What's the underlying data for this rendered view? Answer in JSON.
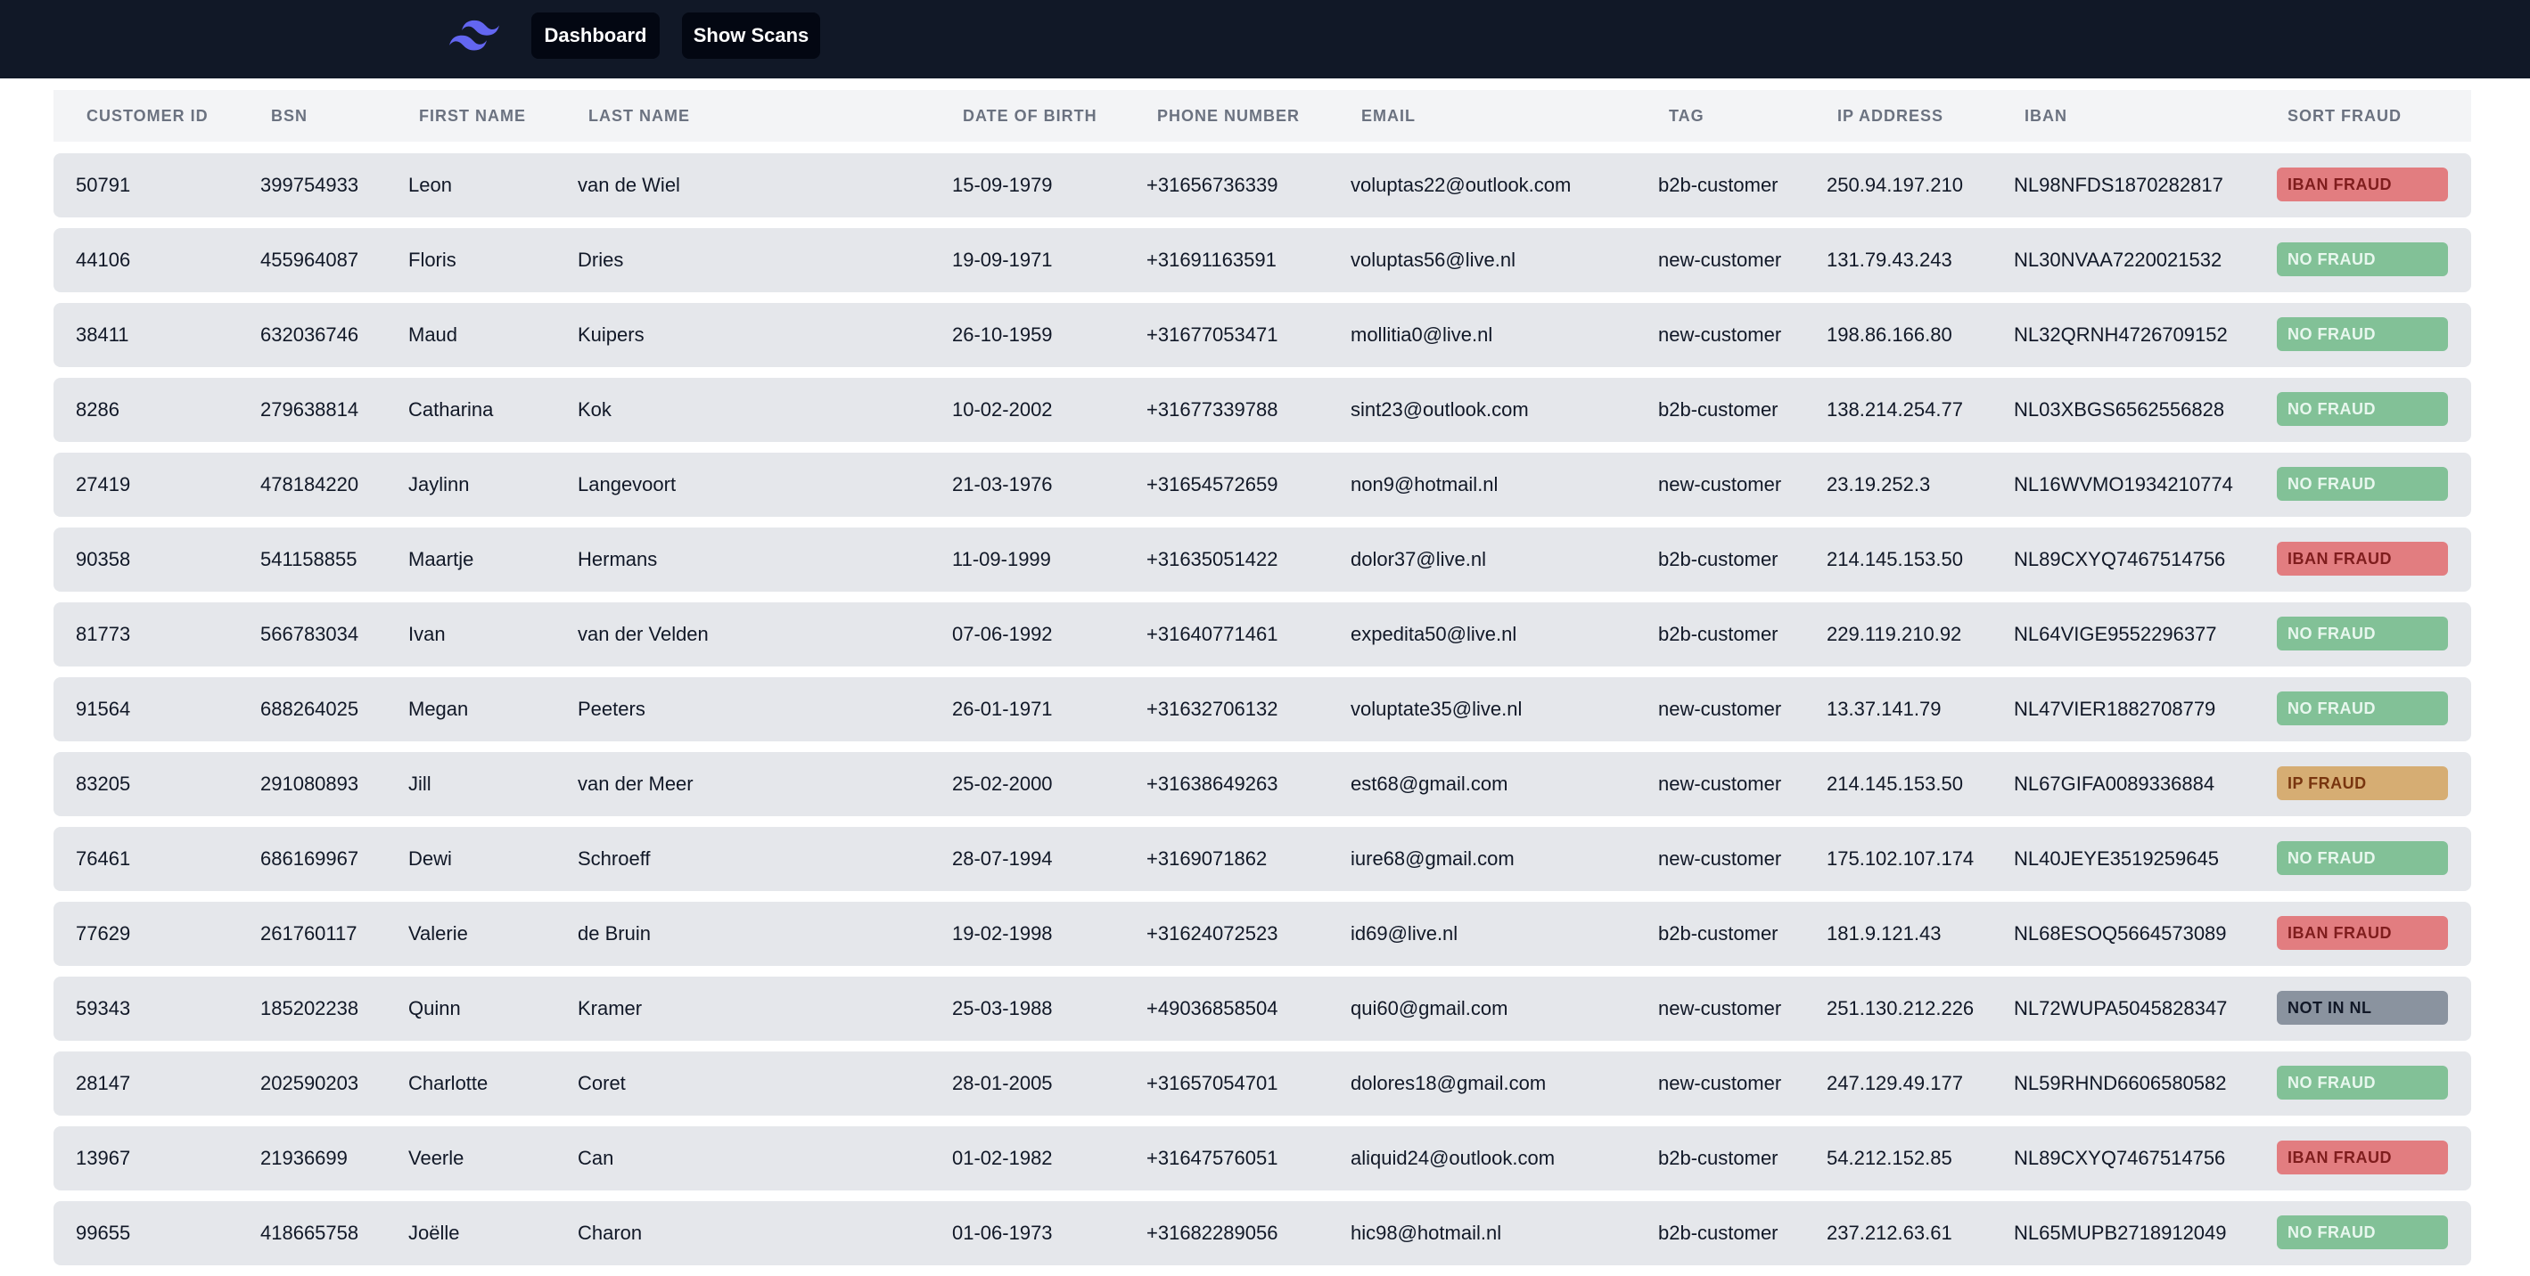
{
  "nav": {
    "logo_icon": "tailwind-logo-icon",
    "dashboard_label": "Dashboard",
    "scans_label": "Show Scans"
  },
  "colors": {
    "topbar": "#111827",
    "iban_fraud": "#e27d80",
    "no_fraud": "#82c197",
    "ip_fraud": "#d6ad73",
    "not_in_nl": "#8a939f"
  },
  "table": {
    "headers": [
      "CUSTOMER ID",
      "BSN",
      "FIRST NAME",
      "LAST NAME",
      "DATE OF BIRTH",
      "PHONE NUMBER",
      "EMAIL",
      "TAG",
      "IP ADDRESS",
      "IBAN",
      "SORT FRAUD"
    ],
    "rows": [
      {
        "customer_id": "50791",
        "bsn": "399754933",
        "first_name": "Leon",
        "last_name": "van de Wiel",
        "dob": "15-09-1979",
        "phone": "+31656736339",
        "email": "voluptas22@outlook.com",
        "tag": "b2b-customer",
        "ip": "250.94.197.210",
        "iban": "NL98NFDS1870282817",
        "fraud": "IBAN FRAUD",
        "fraud_type": "iban"
      },
      {
        "customer_id": "44106",
        "bsn": "455964087",
        "first_name": "Floris",
        "last_name": "Dries",
        "dob": "19-09-1971",
        "phone": "+31691163591",
        "email": "voluptas56@live.nl",
        "tag": "new-customer",
        "ip": "131.79.43.243",
        "iban": "NL30NVAA7220021532",
        "fraud": "NO FRAUD",
        "fraud_type": "no"
      },
      {
        "customer_id": "38411",
        "bsn": "632036746",
        "first_name": "Maud",
        "last_name": "Kuipers",
        "dob": "26-10-1959",
        "phone": "+31677053471",
        "email": "mollitia0@live.nl",
        "tag": "new-customer",
        "ip": "198.86.166.80",
        "iban": "NL32QRNH4726709152",
        "fraud": "NO FRAUD",
        "fraud_type": "no"
      },
      {
        "customer_id": "8286",
        "bsn": "279638814",
        "first_name": "Catharina",
        "last_name": "Kok",
        "dob": "10-02-2002",
        "phone": "+31677339788",
        "email": "sint23@outlook.com",
        "tag": "b2b-customer",
        "ip": "138.214.254.77",
        "iban": "NL03XBGS6562556828",
        "fraud": "NO FRAUD",
        "fraud_type": "no"
      },
      {
        "customer_id": "27419",
        "bsn": "478184220",
        "first_name": "Jaylinn",
        "last_name": "Langevoort",
        "dob": "21-03-1976",
        "phone": "+31654572659",
        "email": "non9@hotmail.nl",
        "tag": "new-customer",
        "ip": "23.19.252.3",
        "iban": "NL16WVMO1934210774",
        "fraud": "NO FRAUD",
        "fraud_type": "no"
      },
      {
        "customer_id": "90358",
        "bsn": "541158855",
        "first_name": "Maartje",
        "last_name": "Hermans",
        "dob": "11-09-1999",
        "phone": "+31635051422",
        "email": "dolor37@live.nl",
        "tag": "b2b-customer",
        "ip": "214.145.153.50",
        "iban": "NL89CXYQ7467514756",
        "fraud": "IBAN FRAUD",
        "fraud_type": "iban"
      },
      {
        "customer_id": "81773",
        "bsn": "566783034",
        "first_name": "Ivan",
        "last_name": "van der Velden",
        "dob": "07-06-1992",
        "phone": "+31640771461",
        "email": "expedita50@live.nl",
        "tag": "b2b-customer",
        "ip": "229.119.210.92",
        "iban": "NL64VIGE9552296377",
        "fraud": "NO FRAUD",
        "fraud_type": "no"
      },
      {
        "customer_id": "91564",
        "bsn": "688264025",
        "first_name": "Megan",
        "last_name": "Peeters",
        "dob": "26-01-1971",
        "phone": "+31632706132",
        "email": "voluptate35@live.nl",
        "tag": "new-customer",
        "ip": "13.37.141.79",
        "iban": "NL47VIER1882708779",
        "fraud": "NO FRAUD",
        "fraud_type": "no"
      },
      {
        "customer_id": "83205",
        "bsn": "291080893",
        "first_name": "Jill",
        "last_name": "van der Meer",
        "dob": "25-02-2000",
        "phone": "+31638649263",
        "email": "est68@gmail.com",
        "tag": "new-customer",
        "ip": "214.145.153.50",
        "iban": "NL67GIFA0089336884",
        "fraud": "IP FRAUD",
        "fraud_type": "ip"
      },
      {
        "customer_id": "76461",
        "bsn": "686169967",
        "first_name": "Dewi",
        "last_name": "Schroeff",
        "dob": "28-07-1994",
        "phone": "+3169071862",
        "email": "iure68@gmail.com",
        "tag": "new-customer",
        "ip": "175.102.107.174",
        "iban": "NL40JEYE3519259645",
        "fraud": "NO FRAUD",
        "fraud_type": "no"
      },
      {
        "customer_id": "77629",
        "bsn": "261760117",
        "first_name": "Valerie",
        "last_name": "de Bruin",
        "dob": "19-02-1998",
        "phone": "+31624072523",
        "email": "id69@live.nl",
        "tag": "b2b-customer",
        "ip": "181.9.121.43",
        "iban": "NL68ESOQ5664573089",
        "fraud": "IBAN FRAUD",
        "fraud_type": "iban"
      },
      {
        "customer_id": "59343",
        "bsn": "185202238",
        "first_name": "Quinn",
        "last_name": "Kramer",
        "dob": "25-03-1988",
        "phone": "+49036858504",
        "email": "qui60@gmail.com",
        "tag": "new-customer",
        "ip": "251.130.212.226",
        "iban": "NL72WUPA5045828347",
        "fraud": "NOT IN NL",
        "fraud_type": "nl"
      },
      {
        "customer_id": "28147",
        "bsn": "202590203",
        "first_name": "Charlotte",
        "last_name": "Coret",
        "dob": "28-01-2005",
        "phone": "+31657054701",
        "email": "dolores18@gmail.com",
        "tag": "new-customer",
        "ip": "247.129.49.177",
        "iban": "NL59RHND6606580582",
        "fraud": "NO FRAUD",
        "fraud_type": "no"
      },
      {
        "customer_id": "13967",
        "bsn": "21936699",
        "first_name": "Veerle",
        "last_name": "Can",
        "dob": "01-02-1982",
        "phone": "+31647576051",
        "email": "aliquid24@outlook.com",
        "tag": "b2b-customer",
        "ip": "54.212.152.85",
        "iban": "NL89CXYQ7467514756",
        "fraud": "IBAN FRAUD",
        "fraud_type": "iban"
      },
      {
        "customer_id": "99655",
        "bsn": "418665758",
        "first_name": "Joëlle",
        "last_name": "Charon",
        "dob": "01-06-1973",
        "phone": "+31682289056",
        "email": "hic98@hotmail.nl",
        "tag": "b2b-customer",
        "ip": "237.212.63.61",
        "iban": "NL65MUPB2718912049",
        "fraud": "NO FRAUD",
        "fraud_type": "no"
      }
    ]
  }
}
